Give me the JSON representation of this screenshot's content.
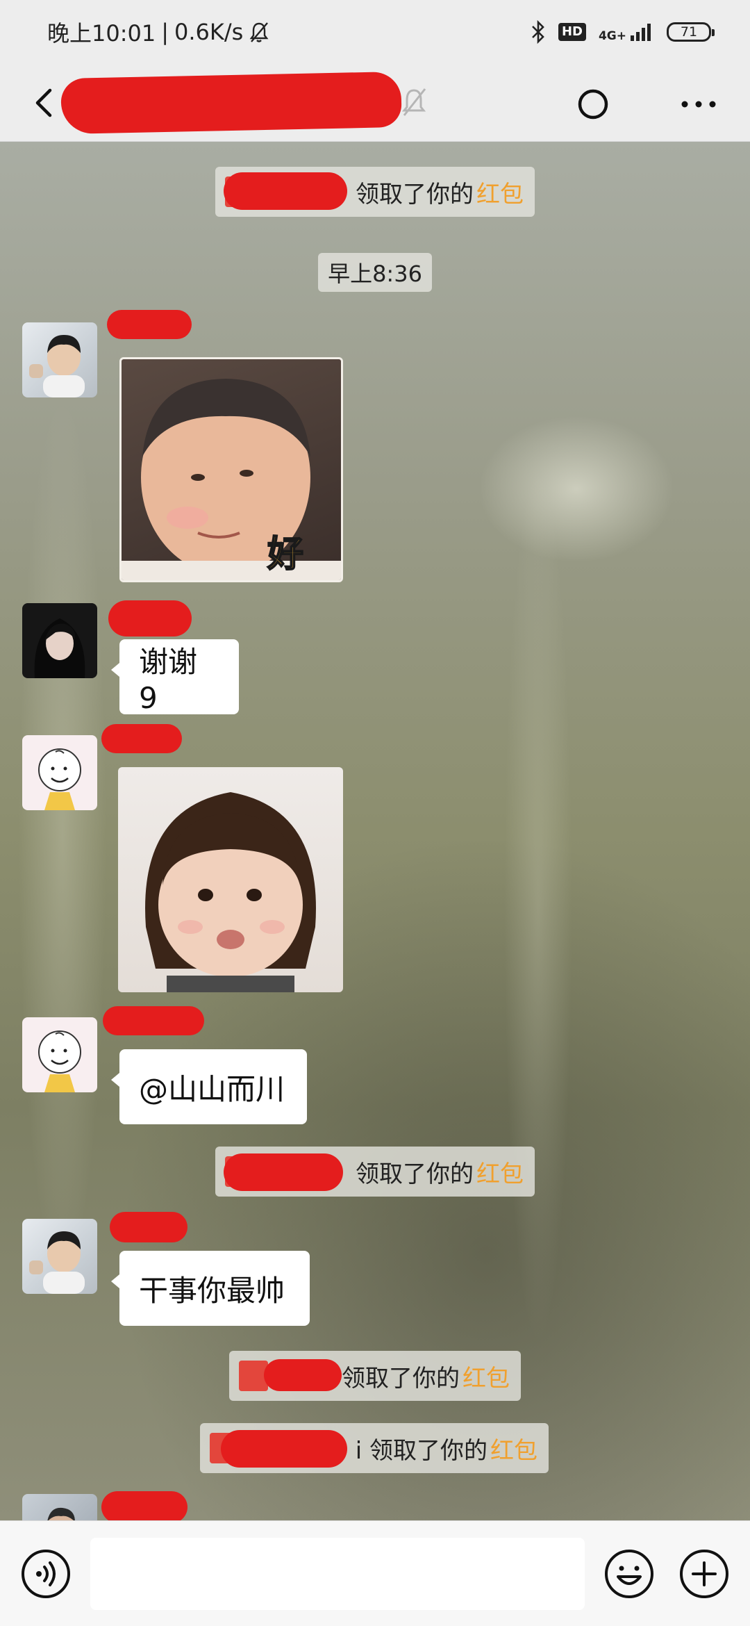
{
  "status_bar": {
    "time": "晚上10:01",
    "net_speed": "0.6K/s",
    "separator": "|",
    "hd": "HD",
    "network": "4G+",
    "battery": "71"
  },
  "chat": {
    "system_messages": [
      {
        "prefix": "领取了你的",
        "accent": "红包"
      },
      {
        "prefix": "领取了你的",
        "accent": "红包"
      },
      {
        "prefix": "领取了你的",
        "accent": "红包"
      },
      {
        "prefix": "i 领取了你的",
        "accent": "红包"
      }
    ],
    "timestamp": "早上8:36",
    "messages": [
      {
        "sticker_caption": "好"
      },
      {
        "text": "谢谢 9"
      },
      {
        "text": "@山山而川"
      },
      {
        "text": "干事你最帅"
      }
    ]
  },
  "colors": {
    "redaction": "#e41d1d",
    "accent": "#f0a02e",
    "bubble": "#ffffff",
    "bar": "#ededed"
  },
  "icons": {
    "back": "chevron-left-icon",
    "mute": "bell-off-icon",
    "refresh": "circle-icon",
    "more": "more-dots-icon",
    "voice": "voice-icon",
    "emoji": "smiley-icon",
    "plus": "plus-icon"
  }
}
